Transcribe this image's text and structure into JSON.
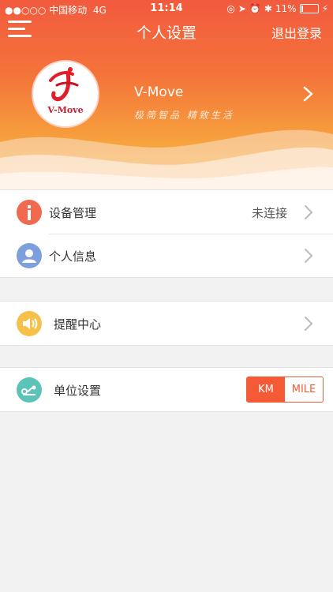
{
  "status_bar": {
    "carrier": "●●○○○ 中国移动",
    "network": "4G",
    "time": "11:14",
    "battery_percent": "11%",
    "battery_level": 0.11
  },
  "nav": {
    "title": "个人设置",
    "logout_label": "退出登录"
  },
  "profile": {
    "logo_text": "V-Move",
    "username": "V-Move",
    "slogan": "极简智品 精致生活"
  },
  "menu": {
    "device": {
      "label": "设备管理",
      "status": "未连接",
      "icon_color": "#ef6a4f"
    },
    "personal": {
      "label": "个人信息",
      "icon_color": "#7d9fdc"
    },
    "reminder": {
      "label": "提醒中心",
      "icon_color": "#f6c14b"
    },
    "units": {
      "label": "单位设置",
      "icon_color": "#5cc3b8",
      "options": [
        "KM",
        "MILE"
      ],
      "selected": "KM"
    }
  },
  "colors": {
    "accent": "#f35a35"
  }
}
